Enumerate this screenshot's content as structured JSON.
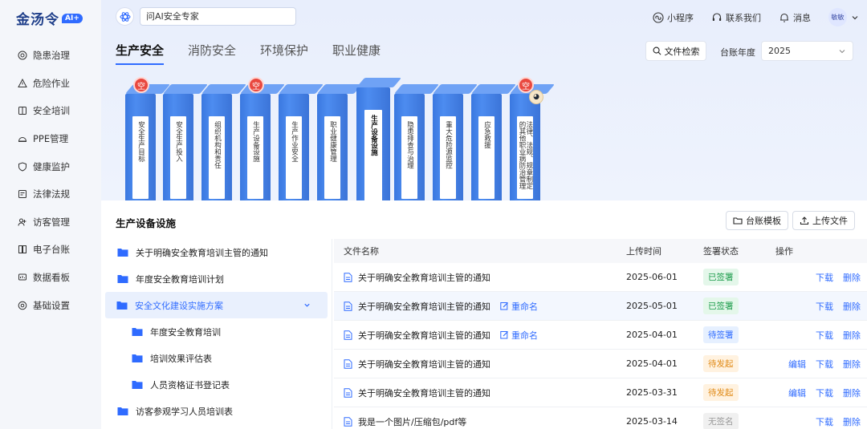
{
  "logo": {
    "text": "金汤令",
    "badge": "AI+"
  },
  "sidebar": {
    "items": [
      {
        "label": "隐患治理",
        "icon": "target-icon"
      },
      {
        "label": "危险作业",
        "icon": "warning-icon"
      },
      {
        "label": "安全培训",
        "icon": "book-icon"
      },
      {
        "label": "PPE管理",
        "icon": "helmet-icon"
      },
      {
        "label": "健康监护",
        "icon": "shield-heart-icon"
      },
      {
        "label": "法律法规",
        "icon": "law-icon"
      },
      {
        "label": "访客管理",
        "icon": "visitor-icon"
      },
      {
        "label": "电子台账",
        "icon": "ledger-icon"
      },
      {
        "label": "数据看板",
        "icon": "dashboard-icon"
      },
      {
        "label": "基础设置",
        "icon": "settings-icon"
      }
    ]
  },
  "topbar": {
    "ai_placeholder": "问AI安全专家",
    "mini_program": "小程序",
    "contact": "联系我们",
    "messages": "消息",
    "avatar": "敏敏"
  },
  "tabs": [
    {
      "label": "生产安全",
      "active": true
    },
    {
      "label": "消防安全",
      "active": false
    },
    {
      "label": "环境保护",
      "active": false
    },
    {
      "label": "职业健康",
      "active": false
    }
  ],
  "toolbar": {
    "file_search": "文件检索",
    "year_label": "台账年度",
    "year_value": "2025"
  },
  "binders": [
    {
      "label": "安全生产目标",
      "empty": true,
      "active": false
    },
    {
      "label": "安全生产投入",
      "empty": false,
      "active": false
    },
    {
      "label": "组织机构和责任",
      "empty": false,
      "active": false
    },
    {
      "label": "生产设备设施",
      "empty": true,
      "active": false
    },
    {
      "label": "生产作业安全",
      "empty": false,
      "active": false
    },
    {
      "label": "职业健康管理",
      "empty": false,
      "active": false
    },
    {
      "label": "生产设备设施",
      "empty": false,
      "active": true
    },
    {
      "label": "隐患排查与治理",
      "empty": false,
      "active": false
    },
    {
      "label": "重大危险源监控",
      "empty": false,
      "active": false
    },
    {
      "label": "应急救援",
      "empty": false,
      "active": false
    },
    {
      "label": "法律、法规、规章制定的其他职业病防治管理",
      "empty": true,
      "active": false
    }
  ],
  "empty_pin": "空",
  "panel": {
    "title": "生产设备设施",
    "template_btn": "台账模板",
    "upload_btn": "上传文件"
  },
  "tree": [
    {
      "label": "关于明确安全教育培训主管的通知",
      "level": 1,
      "active": false
    },
    {
      "label": "年度安全教育培训计划",
      "level": 1,
      "active": false
    },
    {
      "label": "安全文化建设实施方案",
      "level": 1,
      "active": true
    },
    {
      "label": "年度安全教育培训",
      "level": 2,
      "active": false
    },
    {
      "label": "培训效果评估表",
      "level": 2,
      "active": false
    },
    {
      "label": "人员资格证书登记表",
      "level": 2,
      "active": false
    },
    {
      "label": "访客参观学习人员培训表",
      "level": 1,
      "active": false
    }
  ],
  "table": {
    "headers": {
      "name": "文件名称",
      "time": "上传时间",
      "status": "签署状态",
      "ops": "操作"
    },
    "rename_label": "重命名",
    "rows": [
      {
        "name": "关于明确安全教育培训主管的通知",
        "time": "2025-06-01",
        "status": "已签署",
        "status_type": "green",
        "rename": false,
        "ops": [
          "下载",
          "删除"
        ]
      },
      {
        "name": "关于明确安全教育培训主管的通知",
        "time": "2025-05-01",
        "status": "已签署",
        "status_type": "green",
        "rename": true,
        "ops": [
          "下载",
          "删除"
        ]
      },
      {
        "name": "关于明确安全教育培训主管的通知",
        "time": "2025-04-01",
        "status": "待签署",
        "status_type": "blue",
        "rename": true,
        "ops": [
          "下载",
          "删除"
        ]
      },
      {
        "name": "关于明确安全教育培训主管的通知",
        "time": "2025-04-01",
        "status": "待发起",
        "status_type": "orange",
        "rename": false,
        "ops": [
          "编辑",
          "下载",
          "删除"
        ]
      },
      {
        "name": "关于明确安全教育培训主管的通知",
        "time": "2025-03-31",
        "status": "待发起",
        "status_type": "orange",
        "rename": false,
        "ops": [
          "编辑",
          "下载",
          "删除"
        ]
      },
      {
        "name": "我是一个图片/压缩包/pdf等",
        "time": "2025-03-14",
        "status": "无签名",
        "status_type": "gray",
        "rename": false,
        "ops": [
          "下载",
          "删除"
        ]
      }
    ]
  },
  "colors": {
    "accent": "#2f6bff",
    "binder": "#3a78e0",
    "pin": "#e9483f"
  }
}
